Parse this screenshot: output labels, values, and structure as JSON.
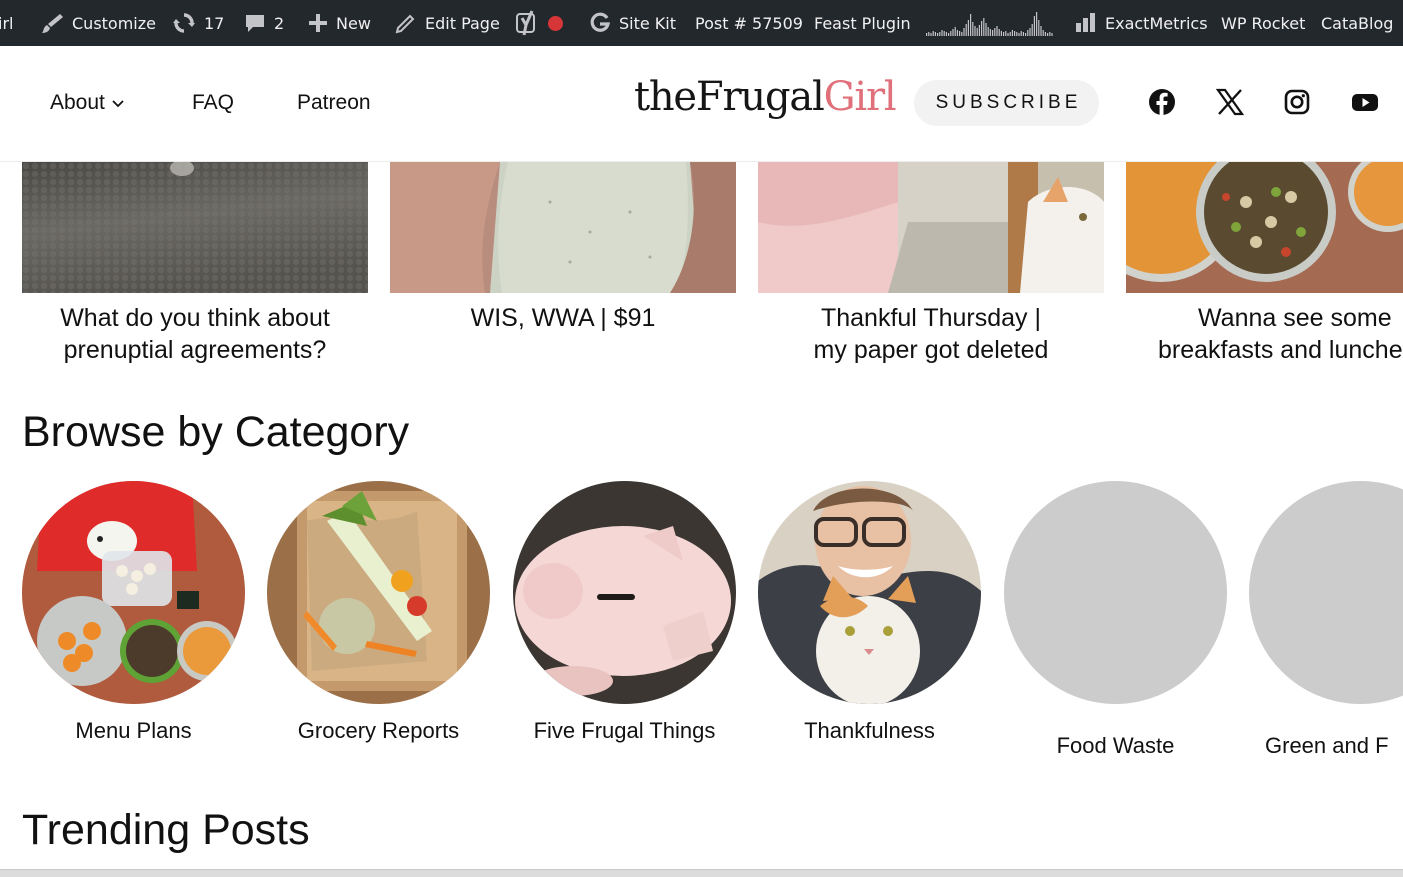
{
  "adminbar": {
    "site_tail": "irl",
    "customize": "Customize",
    "updates_count": "17",
    "comments_count": "2",
    "new": "New",
    "edit_page": "Edit Page",
    "site_kit": "Site Kit",
    "post_id": "Post # 57509",
    "feast_plugin": "Feast Plugin",
    "exactmetrics": "ExactMetrics",
    "wp_rocket": "WP Rocket",
    "catablog": "CataBlog"
  },
  "header": {
    "nav": [
      {
        "label": "About",
        "has_dropdown": true
      },
      {
        "label": "FAQ"
      },
      {
        "label": "Patreon"
      }
    ],
    "logo_main": "theFrugal",
    "logo_accent": "Girl",
    "subscribe": "SUBSCRIBE",
    "social_icons": [
      "facebook-icon",
      "x-icon",
      "instagram-icon",
      "youtube-icon"
    ]
  },
  "posts": [
    {
      "line1": "What do you think about",
      "line2": "prenuptial agreements?"
    },
    {
      "line1": "WIS, WWA | $91",
      "line2": ""
    },
    {
      "line1": "Thankful Thursday |",
      "line2": "my paper got deleted"
    },
    {
      "line1": "Wanna see some",
      "line2": "breakfasts and lunche"
    }
  ],
  "browse_heading": "Browse by Category",
  "categories": [
    {
      "label": "Menu Plans"
    },
    {
      "label": "Grocery Reports"
    },
    {
      "label": "Five Frugal Things"
    },
    {
      "label": "Thankfulness"
    },
    {
      "label": "Food Waste"
    },
    {
      "label": "Green and F"
    }
  ],
  "trending_heading": "Trending Posts",
  "colors": {
    "adminbar_bg": "#23282d",
    "logo_accent": "#e0707a",
    "placeholder_circle": "#cccccc"
  }
}
